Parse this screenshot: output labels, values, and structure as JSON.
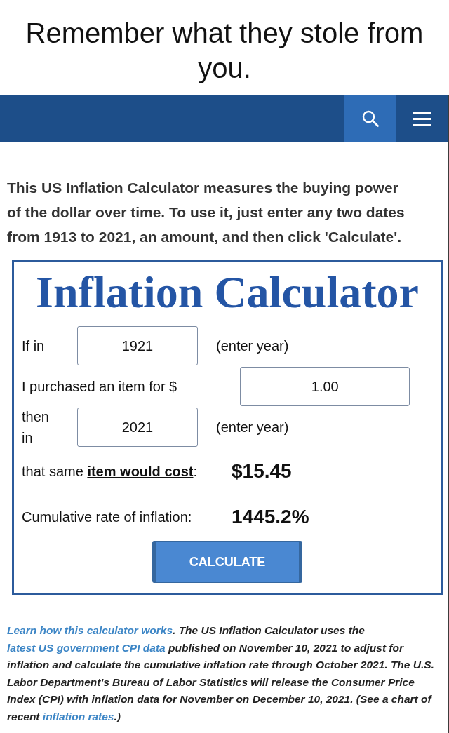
{
  "caption": "Remember what they stole from you.",
  "intro": "This US Inflation Calculator measures the buying power of the dollar over time. To use it, just enter any two dates from 1913 to 2021, an amount, and then click 'Calculate'.",
  "calculator": {
    "title": "Inflation Calculator",
    "fields": [
      {
        "kind": "year",
        "label": "If in",
        "value": "1921",
        "hint": "(enter year)"
      },
      {
        "kind": "amount",
        "label": "I purchased an item for $",
        "value": "1.00"
      },
      {
        "kind": "year",
        "label": "then in",
        "value": "2021",
        "hint": "(enter year)"
      }
    ],
    "results": [
      {
        "label_parts": [
          {
            "kind": "text",
            "text": "that same "
          },
          {
            "kind": "link",
            "text": "item would cost"
          },
          {
            "kind": "text",
            "text": ":"
          }
        ],
        "value": "$15.45"
      },
      {
        "label_parts": [
          {
            "kind": "text",
            "text": "Cumulative rate of inflation:"
          }
        ],
        "value": "1445.2%"
      }
    ],
    "button": "CALCULATE"
  },
  "info": {
    "parts": [
      {
        "kind": "link",
        "text": "Learn how this calculator works"
      },
      {
        "kind": "text",
        "text": ". The US Inflation Calculator uses the "
      },
      {
        "kind": "link",
        "text": "latest US government CPI data"
      },
      {
        "kind": "text",
        "text": " published on November 10, 2021 to adjust for inflation and calculate the cumulative inflation rate through October 2021. The U.S. Labor Department's Bureau of Labor Statistics will release the Consumer Price Index (CPI) with inflation data for November on December 10, 2021. (See a chart of recent "
      },
      {
        "kind": "link",
        "text": "inflation rates"
      },
      {
        "kind": "text",
        "text": ".)"
      }
    ]
  }
}
